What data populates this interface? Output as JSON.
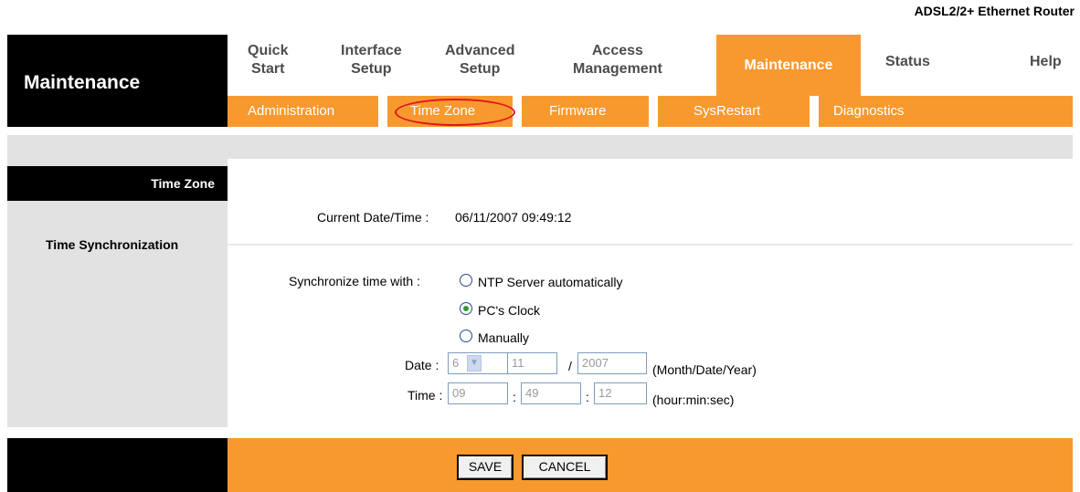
{
  "header": {
    "product": "ADSL2/2+ Ethernet Router",
    "section_title": "Maintenance"
  },
  "nav": {
    "tabs": [
      {
        "line1": "Quick",
        "line2": "Start"
      },
      {
        "line1": "Interface",
        "line2": "Setup"
      },
      {
        "line1": "Advanced",
        "line2": "Setup"
      },
      {
        "line1": "Access",
        "line2": "Management"
      },
      {
        "line1": "Maintenance",
        "line2": ""
      },
      {
        "line1": "Status",
        "line2": ""
      },
      {
        "line1": "Help",
        "line2": ""
      }
    ],
    "subtabs": [
      "Administration",
      "Time Zone",
      "Firmware",
      "SysRestart",
      "Diagnostics"
    ]
  },
  "sidebar": {
    "time_zone": "Time Zone",
    "time_sync": "Time Synchronization"
  },
  "main": {
    "current_label": "Current Date/Time :",
    "current_value": "06/11/2007 09:49:12",
    "sync_label": "Synchronize time with :",
    "options": [
      "NTP Server automatically",
      "PC's Clock",
      "Manually"
    ],
    "selected_option": "PC's Clock",
    "date_label": "Date :",
    "date_month": "6",
    "date_day": "11",
    "date_sep": "/",
    "date_year": "2007",
    "date_hint": "(Month/Date/Year)",
    "time_label": "Time :",
    "time_hour": "09",
    "time_min": "49",
    "time_sec": "12",
    "time_sep": ":",
    "time_hint": "(hour:min:sec)"
  },
  "buttons": {
    "save": "SAVE",
    "cancel": "CANCEL"
  },
  "colors": {
    "accent": "#f8992f",
    "brand_bg": "#000000",
    "panel_gray": "#e2e2e2",
    "highlight_circle": "#e0161a"
  }
}
